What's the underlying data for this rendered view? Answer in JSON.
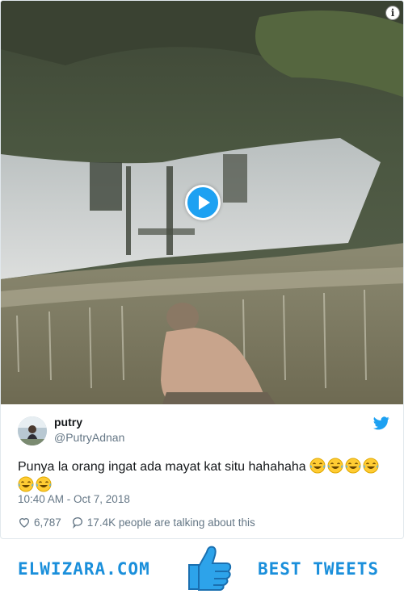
{
  "tweet": {
    "display_name": "putry",
    "handle": "@PutryAdnan",
    "text": "Punya la orang ingat ada mayat kat situ hahahaha",
    "emoji_count": 6,
    "timestamp": "10:40 AM - Oct 7, 2018",
    "likes": "6,787",
    "talking": "17.4K people are talking about this"
  },
  "media": {
    "info_symbol": "i",
    "play_icon": "play-icon"
  },
  "banner": {
    "site": "ELWIZARA.COM",
    "tagline": "BEST TWEETS",
    "icon": "thumbs-up-icon"
  },
  "colors": {
    "twitter_blue": "#1da1f2",
    "banner_blue": "#1a8fdb",
    "muted": "#657786"
  }
}
